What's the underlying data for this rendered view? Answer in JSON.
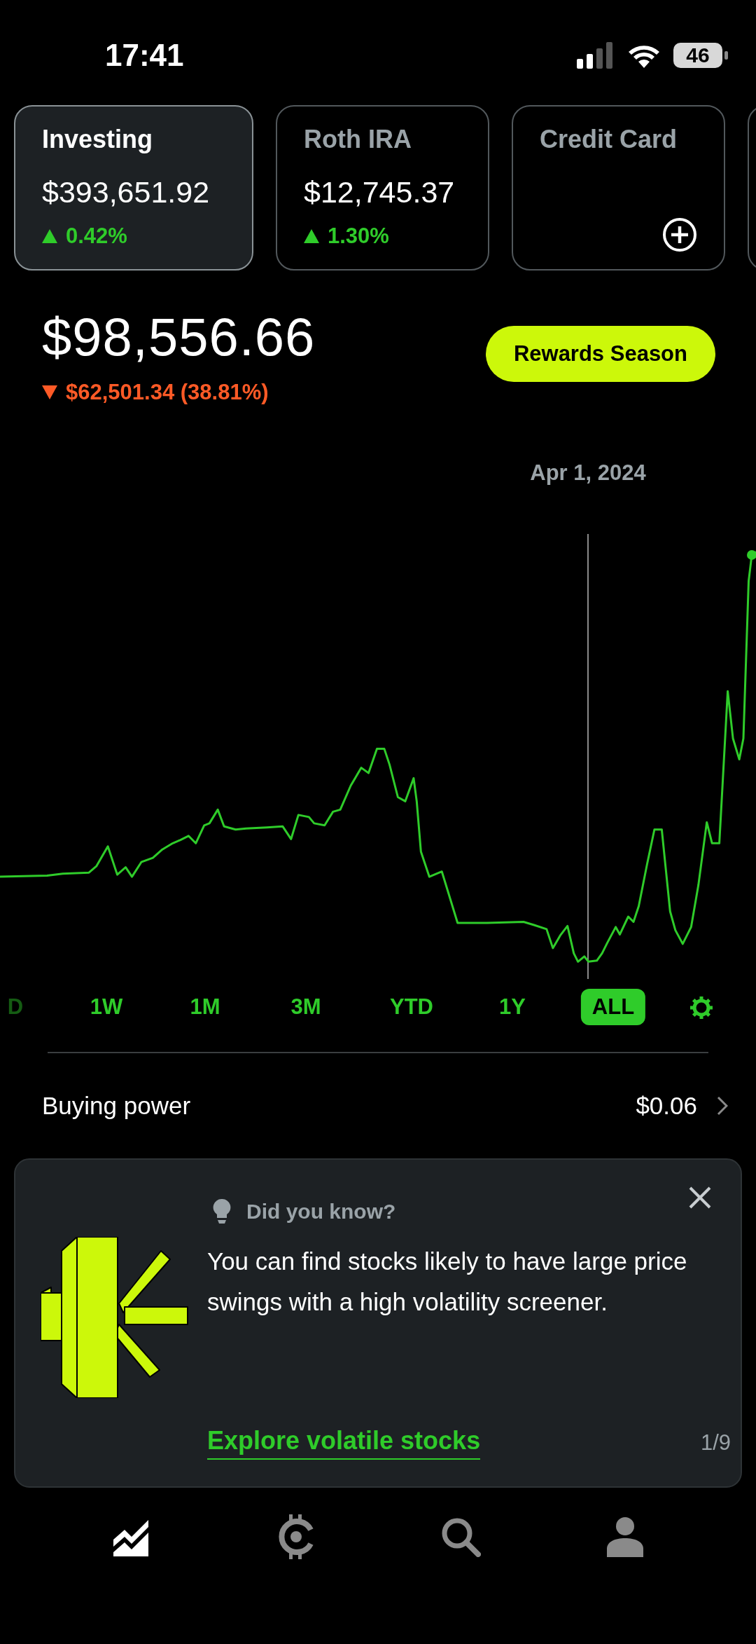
{
  "status_bar": {
    "time": "17:41",
    "battery": "46"
  },
  "accounts": [
    {
      "kind": "account",
      "name": "Investing",
      "value": "$393,651.92",
      "change": "0.42%",
      "selected": true
    },
    {
      "kind": "account",
      "name": "Roth IRA",
      "value": "$12,745.37",
      "change": "1.30%",
      "selected": false
    },
    {
      "kind": "add",
      "name": "Credit Card",
      "selected": false
    }
  ],
  "portfolio": {
    "value": "$98,556.66",
    "change": "$62,501.34 (38.81%)",
    "falling": true,
    "rewards_button": "Rewards Season"
  },
  "chart": {
    "scrub_date": "Apr 1, 2024"
  },
  "ranges": [
    {
      "label": "D",
      "selected": false,
      "cut": true
    },
    {
      "label": "1W",
      "selected": false
    },
    {
      "label": "1M",
      "selected": false
    },
    {
      "label": "3M",
      "selected": false
    },
    {
      "label": "YTD",
      "selected": false
    },
    {
      "label": "1Y",
      "selected": false
    },
    {
      "label": "ALL",
      "selected": true
    }
  ],
  "buying_power": {
    "label": "Buying power",
    "value": "$0.06"
  },
  "tip": {
    "heading": "Did you know?",
    "body": "You can find stocks likely to have large price swings with a high volatility screener.",
    "link": "Explore volatile stocks",
    "pager": "1/9"
  },
  "nav": [
    {
      "kind": "chart",
      "selected": true
    },
    {
      "kind": "crypto",
      "selected": false
    },
    {
      "kind": "search",
      "selected": false
    },
    {
      "kind": "account",
      "selected": false
    }
  ]
}
